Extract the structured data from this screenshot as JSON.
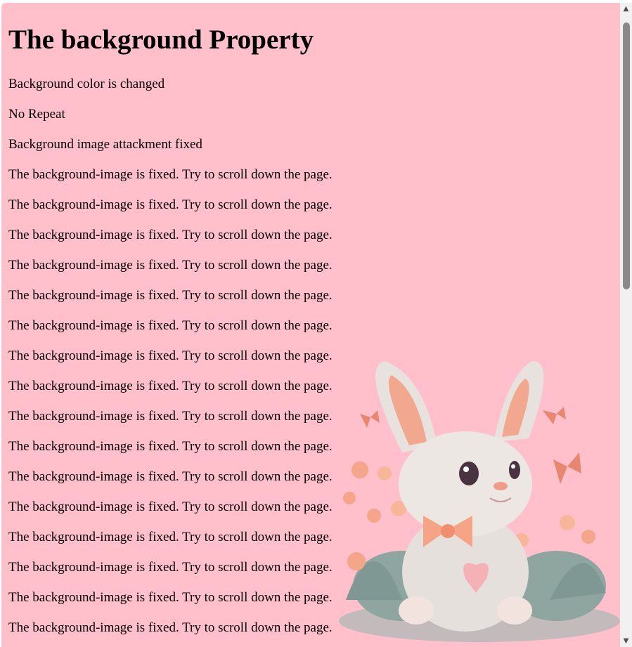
{
  "page": {
    "heading": "The background Property",
    "paragraphs": [
      "Background color is changed",
      "No Repeat",
      "Background image attackment fixed",
      "The background-image is fixed. Try to scroll down the page.",
      "The background-image is fixed. Try to scroll down the page.",
      "The background-image is fixed. Try to scroll down the page.",
      "The background-image is fixed. Try to scroll down the page.",
      "The background-image is fixed. Try to scroll down the page.",
      "The background-image is fixed. Try to scroll down the page.",
      "The background-image is fixed. Try to scroll down the page.",
      "The background-image is fixed. Try to scroll down the page.",
      "The background-image is fixed. Try to scroll down the page.",
      "The background-image is fixed. Try to scroll down the page.",
      "The background-image is fixed. Try to scroll down the page.",
      "The background-image is fixed. Try to scroll down the page.",
      "The background-image is fixed. Try to scroll down the page.",
      "The background-image is fixed. Try to scroll down the page.",
      "The background-image is fixed. Try to scroll down the page.",
      "The background-image is fixed. Try to scroll down the page."
    ]
  },
  "colors": {
    "background": "#ffc0cb",
    "text": "#000000"
  },
  "icons": {
    "background_image": "bunny-illustration",
    "scroll_up": "scroll-up-arrow-icon",
    "scroll_down": "scroll-down-arrow-icon"
  }
}
